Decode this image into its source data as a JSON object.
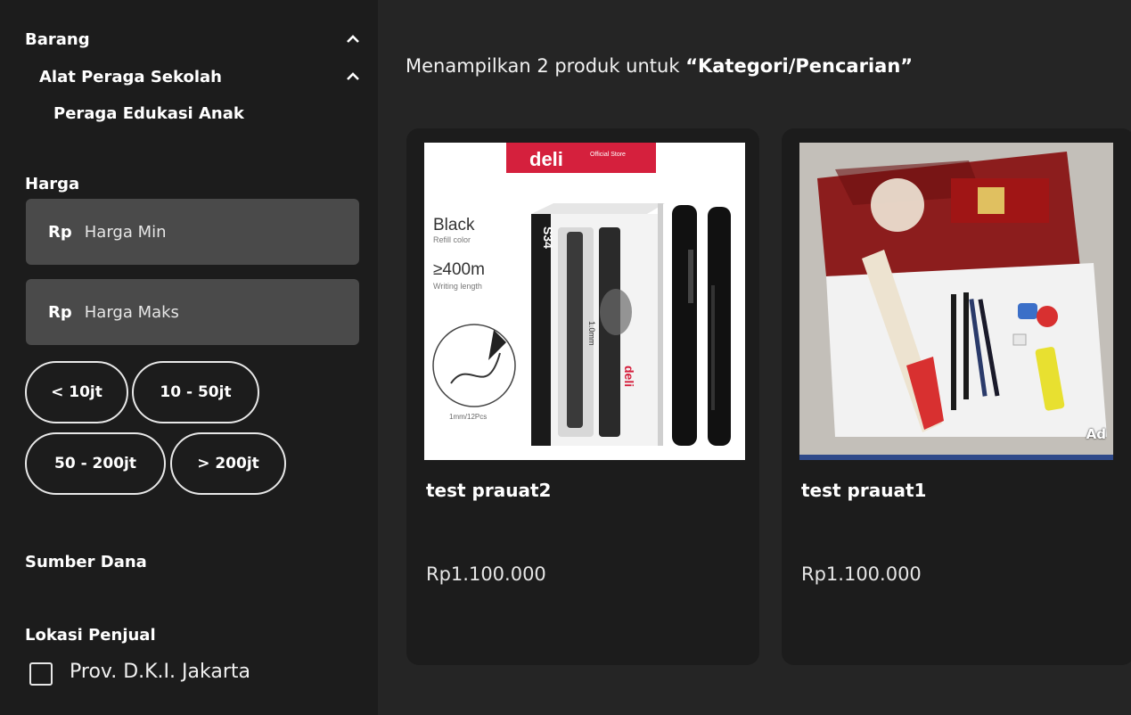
{
  "sidebar": {
    "category": {
      "title": "Barang",
      "sub": "Alat Peraga Sekolah",
      "subsub": "Peraga Edukasi Anak"
    },
    "price": {
      "label": "Harga",
      "min_prefix": "Rp",
      "min_placeholder": "Harga Min",
      "max_prefix": "Rp",
      "max_placeholder": "Harga Maks",
      "ranges": [
        "< 10jt",
        "10 - 50jt",
        "50 - 200jt",
        "> 200jt"
      ]
    },
    "funding_label": "Sumber Dana",
    "location": {
      "label": "Lokasi Penjual",
      "options": [
        {
          "label": "Prov. D.K.I. Jakarta",
          "checked": false
        }
      ]
    }
  },
  "results": {
    "prefix": "Menampilkan 2 produk untuk ",
    "query": "“Kategori/Pencarian”"
  },
  "products": [
    {
      "name": "test prauat2",
      "price": "Rp1.100.000",
      "ad": false
    },
    {
      "name": "test prauat1",
      "price": "Rp1.100.000",
      "ad": true,
      "ad_label": "Ad"
    }
  ],
  "product_image_text": {
    "brand": "deli",
    "store": "Official Store",
    "color": "Black",
    "color_sub": "Refill color",
    "length": "≥400m",
    "length_sub": "Writing length",
    "pack": "1mm/12Pcs",
    "model": "S34",
    "tip": "1.0mm"
  },
  "colors": {
    "sidebar_bg": "#1c1c1c",
    "main_bg": "#252525",
    "input_bg": "#4a4a4a",
    "card_bg": "#1c1c1c"
  }
}
